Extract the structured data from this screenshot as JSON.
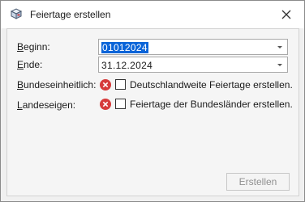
{
  "window": {
    "title": "Feiertage erstellen"
  },
  "icons": {
    "app": "calendar-box-icon",
    "close": "close-icon",
    "error": "error-x-icon",
    "dropdown": "chevron-down-icon"
  },
  "form": {
    "beginn": {
      "label_accel": "B",
      "label_rest": "eginn:",
      "value": "01012024"
    },
    "ende": {
      "label_accel": "E",
      "label_rest": "nde:",
      "value": "31.12.2024"
    },
    "bundeseinheitlich": {
      "label_accel": "B",
      "label_rest": "undeseinheitlich:",
      "checkbox_label": "Deutschlandweite Feiertage erstellen."
    },
    "landeseigen": {
      "label_accel": "L",
      "label_rest": "andeseigen:",
      "checkbox_label": "Feiertage der Bundesländer erstellen."
    }
  },
  "buttons": {
    "create": "Erstellen"
  },
  "colors": {
    "selection": "#0a64d8",
    "error": "#d63a3a",
    "disabled_text": "#8f8f8f"
  }
}
